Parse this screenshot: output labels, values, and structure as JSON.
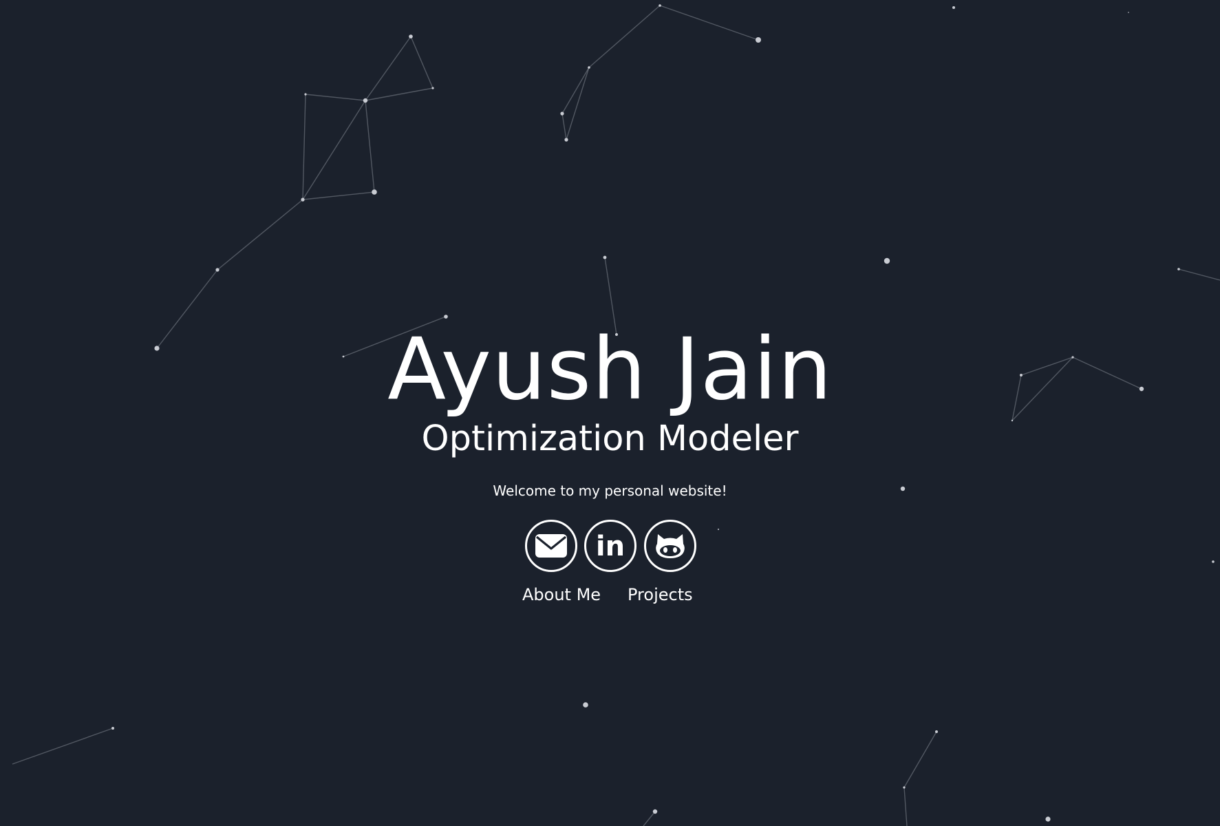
{
  "hero": {
    "name": "Ayush Jain",
    "role": "Optimization Modeler",
    "welcome": "Welcome to my personal website!"
  },
  "social": [
    {
      "icon": "envelope-icon"
    },
    {
      "icon": "linkedin-icon",
      "glyph": "in"
    },
    {
      "icon": "github-icon"
    }
  ],
  "nav": {
    "about_label": "About Me",
    "projects_label": "Projects"
  },
  "colors": {
    "background": "#1b212c",
    "text": "#ffffff",
    "particles": "#c9ccd3"
  }
}
